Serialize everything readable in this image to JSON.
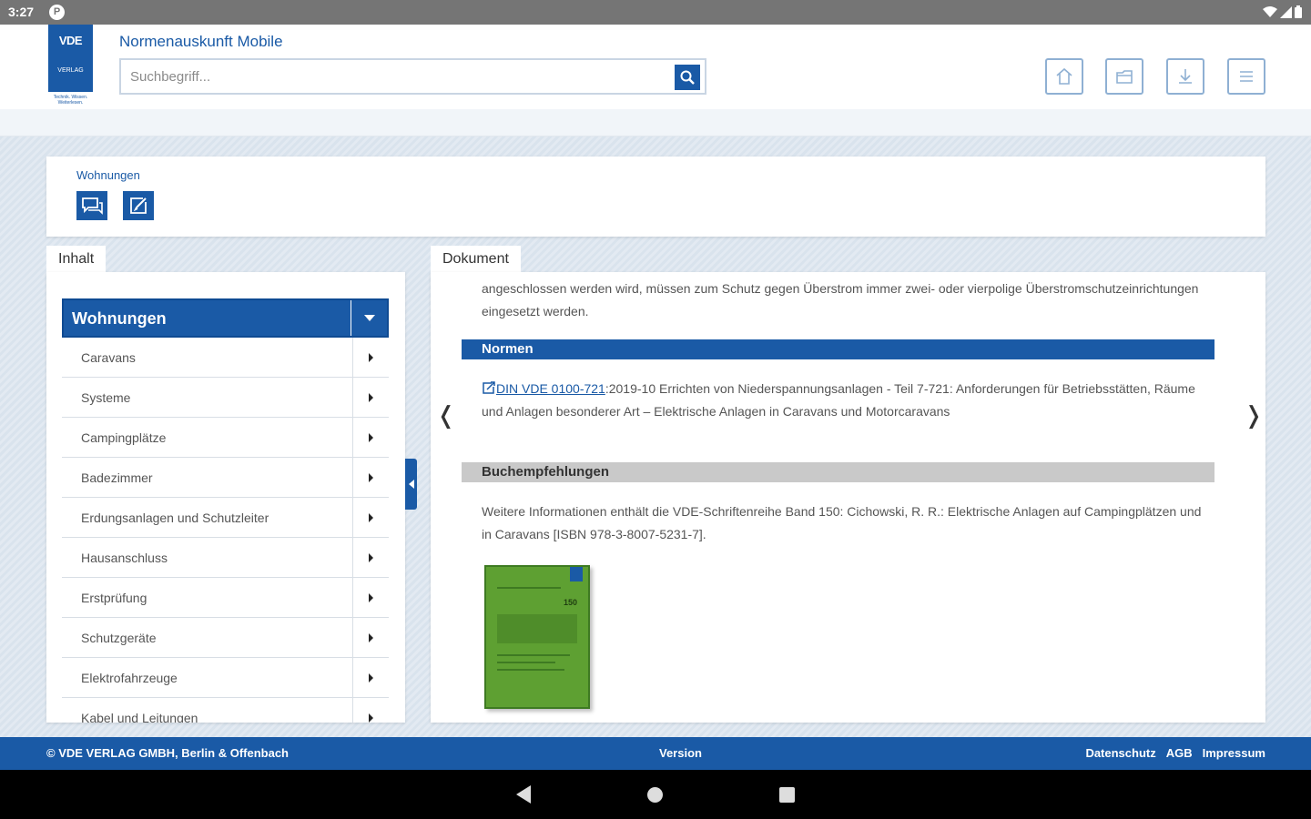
{
  "status_bar": {
    "time": "3:27",
    "notification": "P"
  },
  "header": {
    "logo": {
      "line1": "VDE",
      "line2": "VERLAG",
      "tagline": "Technik. Wissen. Weiterlesen."
    },
    "app_title": "Normenauskunft Mobile",
    "search": {
      "placeholder": "Suchbegriff...",
      "value": ""
    },
    "buttons": [
      "home-icon",
      "folder-icon",
      "download-icon",
      "menu-icon"
    ]
  },
  "breadcrumb": {
    "current": "Wohnungen",
    "actions": [
      "chat-icon",
      "edit-icon"
    ]
  },
  "tabs": {
    "left": "Inhalt",
    "right": "Dokument"
  },
  "sidebar": {
    "selected": "Wohnungen",
    "items": [
      {
        "label": "Caravans"
      },
      {
        "label": "Systeme"
      },
      {
        "label": "Campingplätze"
      },
      {
        "label": "Badezimmer"
      },
      {
        "label": "Erdungsanlagen und Schutzleiter"
      },
      {
        "label": "Hausanschluss"
      },
      {
        "label": "Erstprüfung"
      },
      {
        "label": "Schutzgeräte"
      },
      {
        "label": "Elektrofahrzeuge"
      },
      {
        "label": "Kabel und Leitungen"
      }
    ]
  },
  "document": {
    "intro_text": "angeschlossen werden wird, müssen zum Schutz gegen Überstrom immer zwei- oder vierpolige Überstromschutzeinrichtungen eingesetzt werden.",
    "normen_heading": "Normen",
    "norm": {
      "link_text": "DIN VDE 0100-721",
      "description": ":2019-10 Errichten von Niederspannungsanlagen - Teil 7-721: Anforderungen für Betriebsstätten, Räume und Anlagen besonderer Art – Elektrische Anlagen in Caravans und Motorcaravans"
    },
    "books_heading": "Buchempfehlungen",
    "books_text": "Weitere Informationen enthält die VDE-Schriftenreihe Band 150: Cichowski, R. R.: Elektrische Anlagen auf Campingplätzen und in Caravans [ISBN 978-3-8007-5231-7].",
    "book_cover": {
      "number": "150",
      "color": "#5ea032"
    },
    "prev_symbol": "❬",
    "next_symbol": "❭"
  },
  "footer": {
    "copyright": "© VDE VERLAG GMBH, Berlin & Offenbach",
    "version": "Version",
    "links": [
      "Datenschutz",
      "AGB",
      "Impressum"
    ]
  },
  "colors": {
    "brand": "#1a5aa6",
    "book_green": "#5ea032",
    "section_gray": "#c9c9c9"
  }
}
